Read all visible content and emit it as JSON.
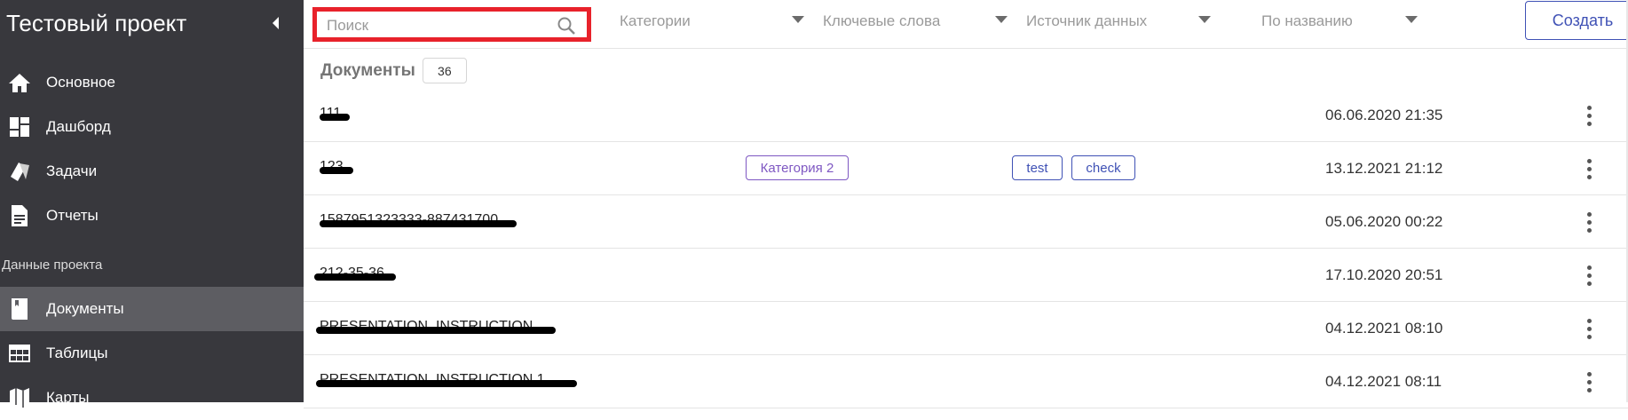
{
  "sidebar": {
    "project_title": "Тестовый проект",
    "nav": [
      {
        "label": "Основное",
        "icon": "home-icon"
      },
      {
        "label": "Дашборд",
        "icon": "dashboard-icon"
      },
      {
        "label": "Задачи",
        "icon": "tasks-icon"
      },
      {
        "label": "Отчеты",
        "icon": "report-icon"
      }
    ],
    "section_label": "Данные проекта",
    "data_nav": [
      {
        "label": "Документы",
        "icon": "book-icon",
        "active": true
      },
      {
        "label": "Таблицы",
        "icon": "table-icon"
      },
      {
        "label": "Карты",
        "icon": "map-icon"
      }
    ]
  },
  "toolbar": {
    "search_placeholder": "Поиск",
    "filters": [
      "Категории",
      "Ключевые слова",
      "Источник данных",
      "По названию"
    ],
    "create_label": "Создать"
  },
  "documents": {
    "title": "Документы",
    "count": "36",
    "rows": [
      {
        "name": "111",
        "date": "06.06.2020 21:35",
        "category": "",
        "tags": []
      },
      {
        "name": "123",
        "date": "13.12.2021 21:12",
        "category": "Категория 2",
        "tags": [
          "test",
          "check"
        ]
      },
      {
        "name": "1587951323333-887431700",
        "date": "05.06.2020 00:22",
        "category": "",
        "tags": []
      },
      {
        "name": "212-35-36",
        "date": "17.10.2020 20:51",
        "category": "",
        "tags": []
      },
      {
        "name": "PRESENTATION_INSTRUCTION",
        "date": "04.12.2021 08:10",
        "category": "",
        "tags": []
      },
      {
        "name": "PRESENTATION_INSTRUCTION 1",
        "date": "04.12.2021 08:11",
        "category": "",
        "tags": []
      }
    ]
  },
  "colors": {
    "sidebar_bg": "#38383d",
    "sidebar_active": "#5d5d62",
    "accent": "#3f51b5",
    "category_chip": "#7e57c2",
    "search_highlight": "#e8222b"
  }
}
